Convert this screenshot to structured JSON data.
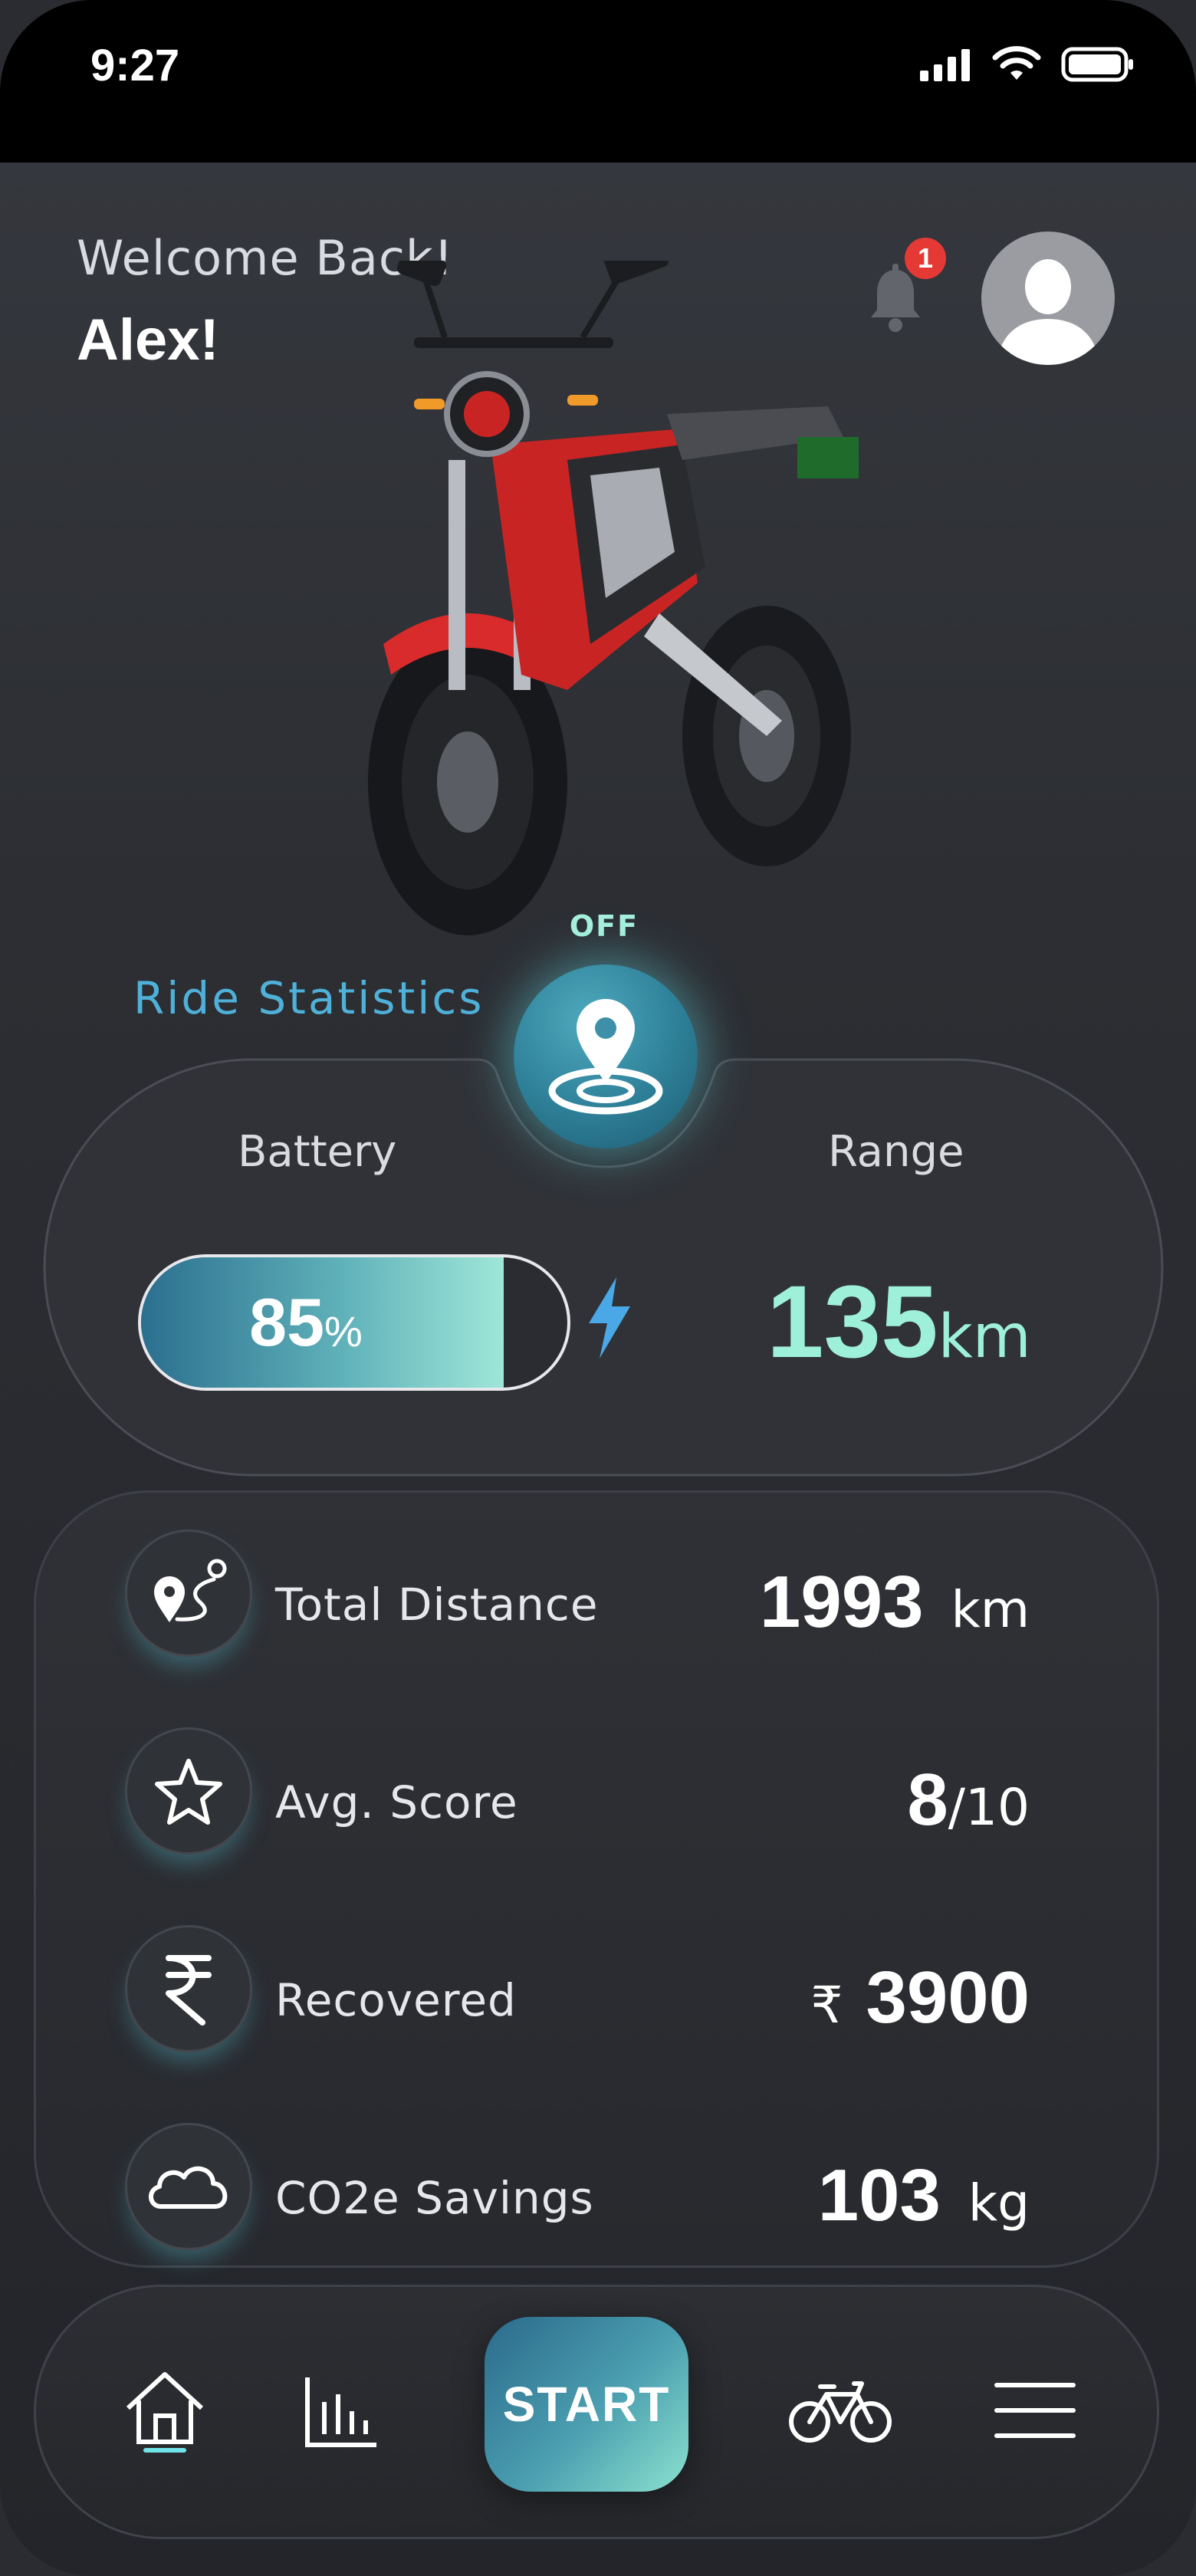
{
  "status_bar": {
    "time": "9:27"
  },
  "header": {
    "welcome": "Welcome Back!",
    "username": "Alex!",
    "notification_count": "1"
  },
  "ride_statistics": {
    "title": "Ride Statistics",
    "toggle_state": "OFF",
    "battery_label": "Battery",
    "battery_value": "85",
    "battery_unit": "%",
    "battery_level": 0.85,
    "range_label": "Range",
    "range_value": "135",
    "range_unit": "km"
  },
  "stats": [
    {
      "label": "Total Distance",
      "value": "1993",
      "unit": "km",
      "icon": "route-icon"
    },
    {
      "label": "Avg. Score",
      "value": "8",
      "unit": "/10",
      "icon": "star-icon"
    },
    {
      "label": "Recovered",
      "prefix": "₹",
      "value": "3900",
      "icon": "rupee-icon"
    },
    {
      "label": "CO2e Savings",
      "value": "103",
      "unit": "kg",
      "icon": "cloud-icon"
    }
  ],
  "nav": {
    "start_label": "START",
    "items": [
      "home-icon",
      "stats-chart-icon",
      "bicycle-icon",
      "menu-icon"
    ]
  },
  "colors": {
    "accent_teal": "#9ef0d9",
    "accent_blue": "#4fb0d8",
    "badge_red": "#e53935",
    "bike_red": "#d92b2b"
  }
}
